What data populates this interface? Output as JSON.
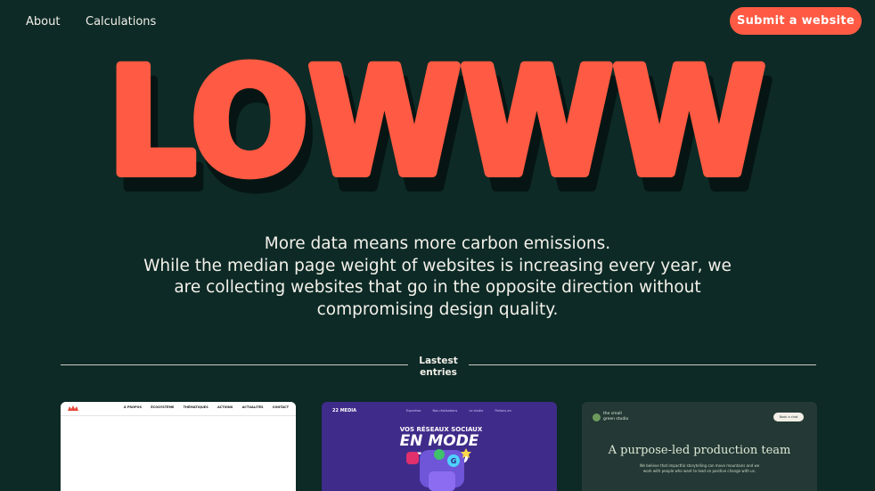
{
  "nav": {
    "about": "About",
    "calculations": "Calculations",
    "submit": "Submit a website"
  },
  "hero": {
    "logo_text": "LOWWW",
    "colors": {
      "primary": "#ff5a43",
      "shadow": "#061513",
      "background": "#0d2a26"
    }
  },
  "tagline": {
    "line1": "More data means more carbon emissions.",
    "line2": "While the median page weight of websites is increasing every year, we",
    "line3": "are collecting websites that go in the opposite direction without",
    "line4": "compromising design quality."
  },
  "divider": {
    "line1": "Lastest",
    "line2": "entries"
  },
  "entries": [
    {
      "menu": [
        "À PROPOS",
        "ÉCOSYSTÈME",
        "THÉMATIQUES",
        "ACTIONS",
        "ACTUALITÉS",
        "CONTACT"
      ]
    },
    {
      "logo": "22 MEDIA",
      "nav": [
        "Expertise",
        "Nos réalisations",
        "Le studio",
        "Parlons-en"
      ],
      "headline_small": "VOS RÉSEAUX SOCIAUX",
      "headline_big": "EN MODE TURBO"
    },
    {
      "brand_line1": "the small",
      "brand_line2": "green studio",
      "button": "Book a chat",
      "title": "A purpose-led production team",
      "text_line1": "We believe that impactful storytelling can move mountains and we",
      "text_line2": "work with people who want to lead on positive change with us."
    }
  ]
}
